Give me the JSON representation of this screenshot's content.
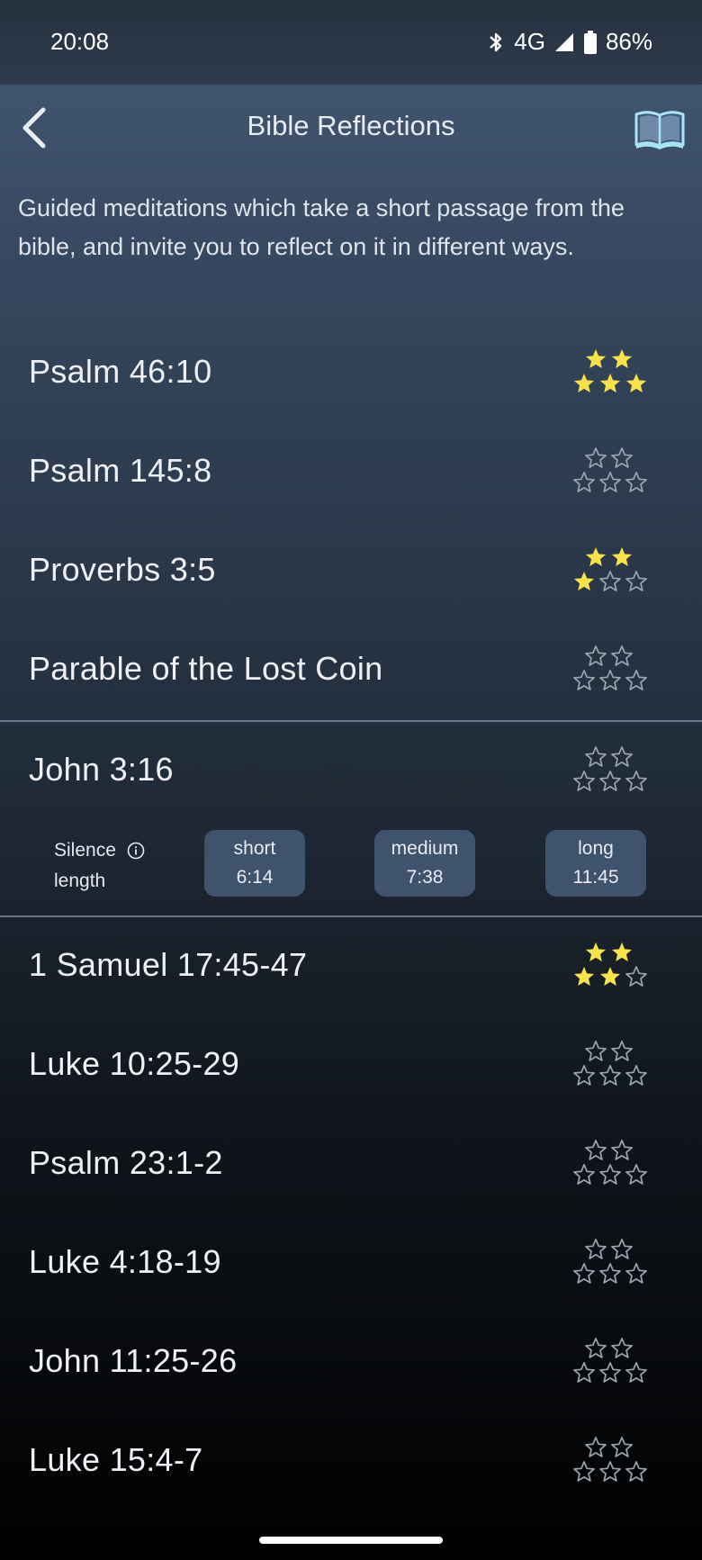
{
  "status_bar": {
    "time": "20:08",
    "network": "4G",
    "battery": "86%",
    "icons": [
      "bluetooth-icon",
      "signal-icon",
      "battery-icon"
    ]
  },
  "app_bar": {
    "title": "Bible Reflections",
    "back_icon": "chevron-left-icon",
    "action_icon": "open-book-icon"
  },
  "description": "Guided meditations which take a short passage from the bible, and invite you to reflect on it in different ways.",
  "colors": {
    "star_filled": "#f7e347",
    "star_empty": "#9aa3ae",
    "length_button_bg": "#40536d"
  },
  "items": [
    {
      "title": "Psalm 46:10",
      "rating": 5
    },
    {
      "title": "Psalm 145:8",
      "rating": 0
    },
    {
      "title": "Proverbs 3:5",
      "rating": 3
    },
    {
      "title": "Parable of the Lost Coin",
      "rating": 0
    },
    {
      "title": "John 3:16",
      "rating": 0,
      "expanded": true
    },
    {
      "title": "1 Samuel 17:45-47",
      "rating": 4
    },
    {
      "title": "Luke 10:25-29",
      "rating": 0
    },
    {
      "title": "Psalm 23:1-2",
      "rating": 0
    },
    {
      "title": "Luke 4:18-19",
      "rating": 0
    },
    {
      "title": "John 11:25-26",
      "rating": 0
    },
    {
      "title": "Luke 15:4-7",
      "rating": 0
    }
  ],
  "silence": {
    "label_line1": "Silence",
    "label_line2": "length",
    "options": [
      {
        "name": "short",
        "duration": "6:14"
      },
      {
        "name": "medium",
        "duration": "7:38"
      },
      {
        "name": "long",
        "duration": "11:45"
      }
    ]
  },
  "watermark": "UpdateStar.com"
}
